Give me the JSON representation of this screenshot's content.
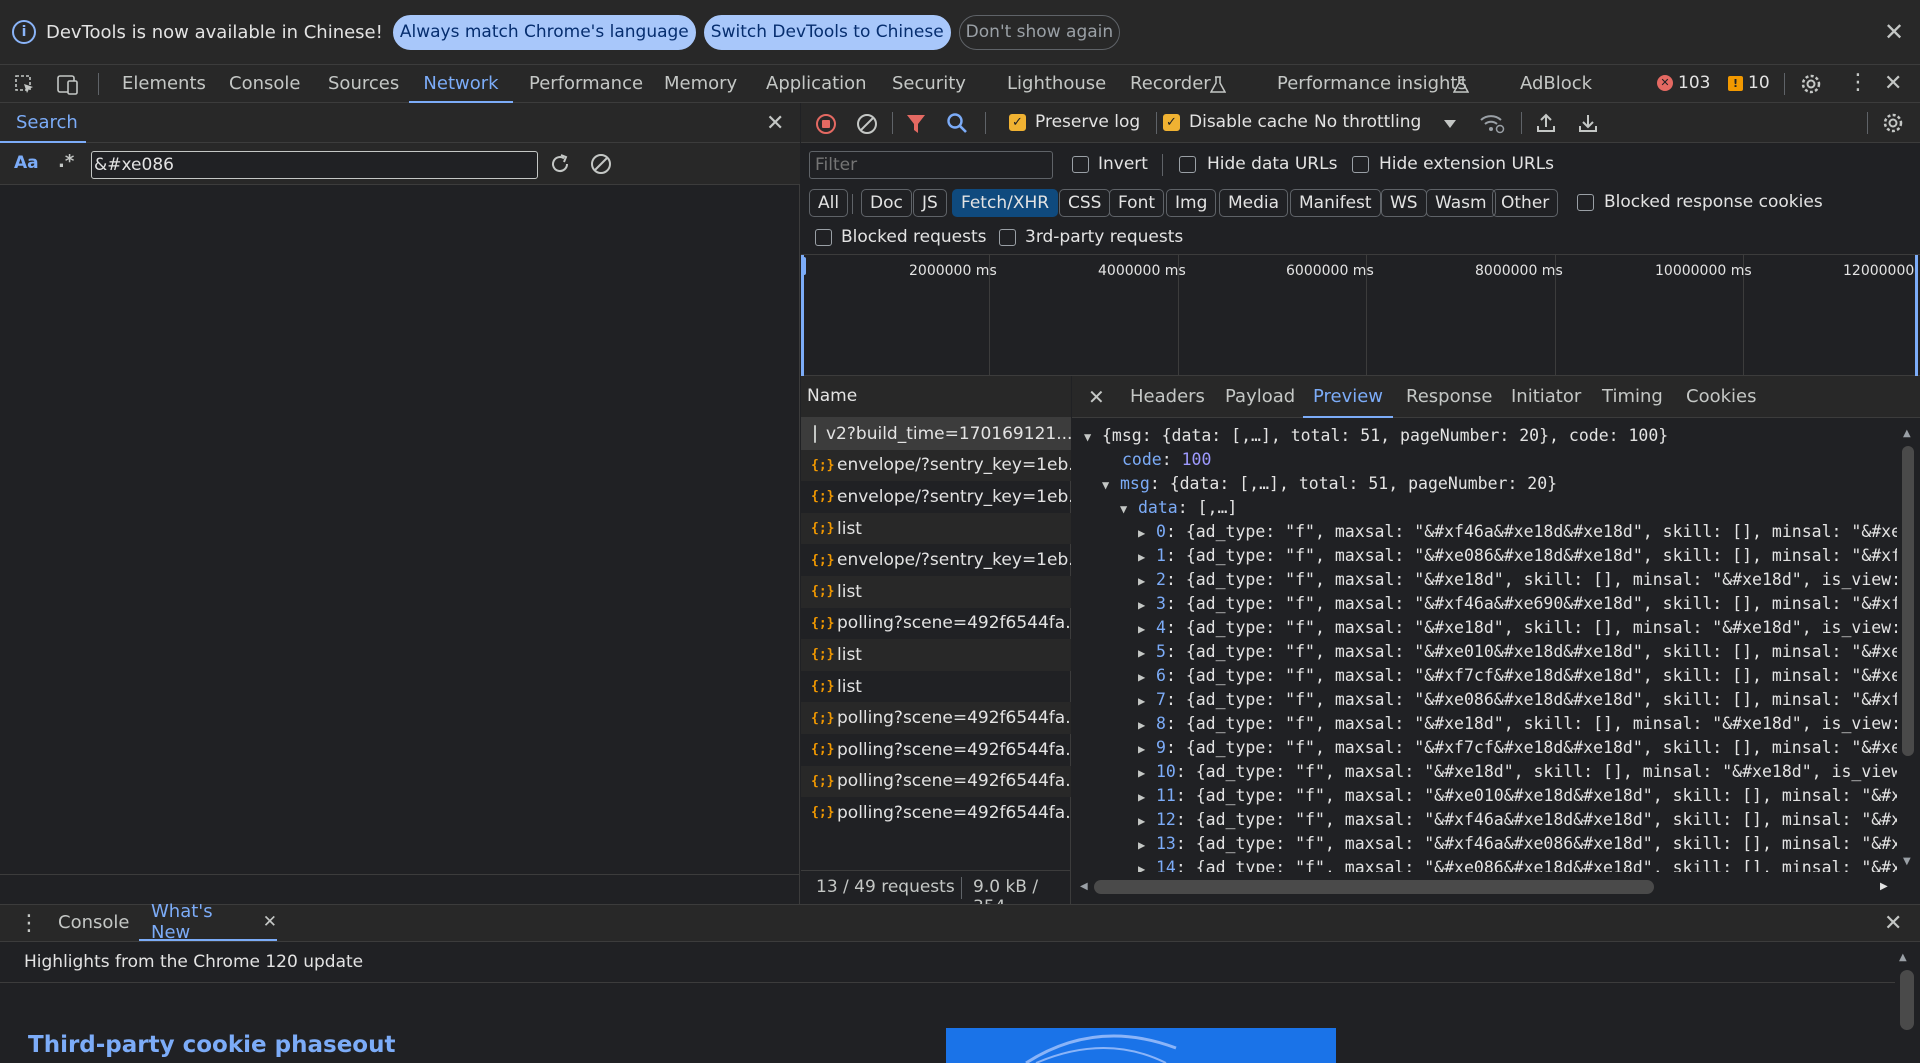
{
  "infobar": {
    "message": "DevTools is now available in Chinese!",
    "btn_match": "Always match Chrome's language",
    "btn_switch": "Switch DevTools to Chinese",
    "btn_dismiss": "Don't show again"
  },
  "tabs": [
    "Elements",
    "Console",
    "Sources",
    "Network",
    "Performance",
    "Memory",
    "Application",
    "Security",
    "Lighthouse",
    "Recorder",
    "Performance insights",
    "AdBlock"
  ],
  "active_tab": "Network",
  "status": {
    "errors": "103",
    "warnings": "10"
  },
  "search": {
    "title": "Search",
    "case_label": "Aa",
    "regex_label": ".*",
    "query": "&#xe086"
  },
  "network": {
    "preserve_log": "Preserve log",
    "disable_cache": "Disable cache",
    "throttling": "No throttling",
    "filter_placeholder": "Filter",
    "invert": "Invert",
    "hide_data_urls": "Hide data URLs",
    "hide_ext_urls": "Hide extension URLs",
    "types": [
      "All",
      "Doc",
      "JS",
      "Fetch/XHR",
      "CSS",
      "Font",
      "Img",
      "Media",
      "Manifest",
      "WS",
      "Wasm",
      "Other"
    ],
    "active_type": "Fetch/XHR",
    "blocked_cookies": "Blocked response cookies",
    "blocked_requests": "Blocked requests",
    "third_party": "3rd-party requests",
    "timeline_labels": [
      "2000000 ms",
      "4000000 ms",
      "6000000 ms",
      "8000000 ms",
      "10000000 ms",
      "12000000"
    ],
    "name_header": "Name",
    "requests": [
      {
        "name": "v2?build_time=170169121...",
        "type": "doc"
      },
      {
        "name": "envelope/?sentry_key=1eb...",
        "type": "xhr"
      },
      {
        "name": "envelope/?sentry_key=1eb...",
        "type": "xhr"
      },
      {
        "name": "list",
        "type": "xhr"
      },
      {
        "name": "envelope/?sentry_key=1eb...",
        "type": "xhr"
      },
      {
        "name": "list",
        "type": "xhr"
      },
      {
        "name": "polling?scene=492f6544fa...",
        "type": "xhr"
      },
      {
        "name": "list",
        "type": "xhr"
      },
      {
        "name": "list",
        "type": "xhr"
      },
      {
        "name": "polling?scene=492f6544fa...",
        "type": "xhr"
      },
      {
        "name": "polling?scene=492f6544fa...",
        "type": "xhr"
      },
      {
        "name": "polling?scene=492f6544fa...",
        "type": "xhr"
      },
      {
        "name": "polling?scene=492f6544fa...",
        "type": "xhr"
      }
    ],
    "footer_requests": "13 / 49 requests",
    "footer_size": "9.0 kB / 354"
  },
  "preview": {
    "tabs": [
      "Headers",
      "Payload",
      "Preview",
      "Response",
      "Initiator",
      "Timing",
      "Cookies"
    ],
    "active_tab": "Preview",
    "root": "{msg: {data: [,…], total: 51, pageNumber: 20}, code: 100}",
    "code_key": "code",
    "code_value": "100",
    "msg_key": "msg",
    "msg_value": "{data: [,…], total: 51, pageNumber: 20}",
    "data_key": "data",
    "data_value": "[,…]",
    "items": [
      {
        "idx": "0",
        "text": "{ad_type: \"f\", maxsal: \"&#xf46a&#xe18d&#xe18d\", skill: [], minsal: \"&#xe"
      },
      {
        "idx": "1",
        "text": "{ad_type: \"f\", maxsal: \"&#xe086&#xe18d&#xe18d\", skill: [], minsal: \"&#xf"
      },
      {
        "idx": "2",
        "text": "{ad_type: \"f\", maxsal: \"&#xe18d\", skill: [], minsal: \"&#xe18d\", is_view:"
      },
      {
        "idx": "3",
        "text": "{ad_type: \"f\", maxsal: \"&#xf46a&#xe690&#xe18d\", skill: [], minsal: \"&#xf"
      },
      {
        "idx": "4",
        "text": "{ad_type: \"f\", maxsal: \"&#xe18d\", skill: [], minsal: \"&#xe18d\", is_view:"
      },
      {
        "idx": "5",
        "text": "{ad_type: \"f\", maxsal: \"&#xe010&#xe18d&#xe18d\", skill: [], minsal: \"&#xe"
      },
      {
        "idx": "6",
        "text": "{ad_type: \"f\", maxsal: \"&#xf7cf&#xe18d&#xe18d\", skill: [], minsal: \"&#xe"
      },
      {
        "idx": "7",
        "text": "{ad_type: \"f\", maxsal: \"&#xe086&#xe18d&#xe18d\", skill: [], minsal: \"&#xf"
      },
      {
        "idx": "8",
        "text": "{ad_type: \"f\", maxsal: \"&#xe18d\", skill: [], minsal: \"&#xe18d\", is_view:"
      },
      {
        "idx": "9",
        "text": "{ad_type: \"f\", maxsal: \"&#xf7cf&#xe18d&#xe18d\", skill: [], minsal: \"&#xe"
      },
      {
        "idx": "10",
        "text": "{ad_type: \"f\", maxsal: \"&#xe18d\", skill: [], minsal: \"&#xe18d\", is_view"
      },
      {
        "idx": "11",
        "text": "{ad_type: \"f\", maxsal: \"&#xe010&#xe18d&#xe18d\", skill: [], minsal: \"&#x"
      },
      {
        "idx": "12",
        "text": "{ad_type: \"f\", maxsal: \"&#xf46a&#xe18d&#xe18d\", skill: [], minsal: \"&#x"
      },
      {
        "idx": "13",
        "text": "{ad_type: \"f\", maxsal: \"&#xf46a&#xe086&#xe18d\", skill: [], minsal: \"&#x"
      },
      {
        "idx": "14",
        "text": "{ad_type: \"f\", maxsal: \"&#xe086&#xe18d&#xe18d\", skill: [], minsal: \"&#x"
      }
    ]
  },
  "drawer": {
    "tabs": [
      "Console",
      "What's New"
    ],
    "active_tab": "What's New",
    "highlights": "Highlights from the Chrome 120 update",
    "heading": "Third-party cookie phaseout"
  },
  "colors": {
    "accent": "#7cacf8",
    "checkbox": "#f0b232",
    "error": "#e46962",
    "warning": "#f29900",
    "record": "#e46962"
  }
}
